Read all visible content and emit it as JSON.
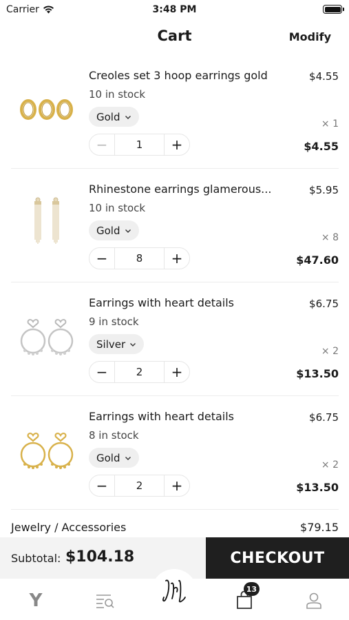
{
  "status_bar": {
    "carrier": "Carrier",
    "time": "3:48 PM"
  },
  "nav": {
    "title": "Cart",
    "modify_label": "Modify"
  },
  "items": [
    {
      "name": "Creoles set 3 hoop earrings gold",
      "stock": "10 in stock",
      "variant": "Gold",
      "quantity": "1",
      "unit_price": "$4.55",
      "multiplier": "× 1",
      "line_total": "$4.55",
      "qty_min_reached": true,
      "thumb": "gold-hoop-earrings-icon"
    },
    {
      "name": "Rhinestone earrings glamerous...",
      "stock": "10 in stock",
      "variant": "Gold",
      "quantity": "8",
      "unit_price": "$5.95",
      "multiplier": "× 8",
      "line_total": "$47.60",
      "qty_min_reached": false,
      "thumb": "rhinestone-earrings-icon"
    },
    {
      "name": "Earrings with heart details",
      "stock": "9 in stock",
      "variant": "Silver",
      "quantity": "2",
      "unit_price": "$6.75",
      "multiplier": "× 2",
      "line_total": "$13.50",
      "qty_min_reached": false,
      "thumb": "silver-heart-earrings-icon"
    },
    {
      "name": "Earrings with heart details",
      "stock": "8 in stock",
      "variant": "Gold",
      "quantity": "2",
      "unit_price": "$6.75",
      "multiplier": "× 2",
      "line_total": "$13.50",
      "qty_min_reached": false,
      "thumb": "gold-heart-earrings-icon"
    }
  ],
  "category": {
    "label": "Jewelry / Accessories",
    "total": "$79.15"
  },
  "subtotal": {
    "label": "Subtotal:",
    "value": "$104.18"
  },
  "checkout": {
    "label": "CHECKOUT"
  },
  "tab_bar": {
    "cart_badge": "13"
  },
  "colors": {
    "gold": "#d8b14a",
    "silver": "#b9b9b9",
    "checkout_bg": "#1f1f1f",
    "subtotal_bg": "#f3f3f3"
  }
}
